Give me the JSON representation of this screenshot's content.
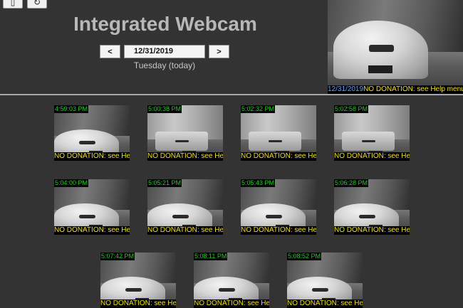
{
  "toolbar": {
    "btn1_glyph": "▯",
    "btn2_glyph": "↻",
    "btn1_icon": "window-icon",
    "btn2_icon": "refresh-icon"
  },
  "header": {
    "title": "Integrated Webcam",
    "prev_label": "<",
    "next_label": ">",
    "date_value": "12/31/2019",
    "day_text": "Tuesday (today)"
  },
  "preview": {
    "date": "12/31/2019",
    "message": "NO DONATION: see Help menu"
  },
  "thumbnails": [
    {
      "time": "4:59:03 PM",
      "caption": "NO DONATION: see Help menu",
      "scene": "car"
    },
    {
      "time": "5:00:38 PM",
      "caption": "NO DONATION: see Help menu",
      "scene": "truck"
    },
    {
      "time": "5:02:32 PM",
      "caption": "NO DONATION: see Help menu",
      "scene": "truck"
    },
    {
      "time": "5:02:58 PM",
      "caption": "NO DONATION: see Help menu",
      "scene": "truck"
    },
    {
      "time": "5:04:00 PM",
      "caption": "NO DONATION: see Help menu",
      "scene": "car"
    },
    {
      "time": "5:05:21 PM",
      "caption": "NO DONATION: see Help menu",
      "scene": "car"
    },
    {
      "time": "5:05:43 PM",
      "caption": "NO DONATION: see Help menu",
      "scene": "car"
    },
    {
      "time": "5:06:28 PM",
      "caption": "NO DONATION: see Help menu",
      "scene": "car"
    },
    {
      "time": "5:07:42 PM",
      "caption": "NO DONATION: see Help menu",
      "scene": "car"
    },
    {
      "time": "5:08:11 PM",
      "caption": "NO DONATION: see Help menu",
      "scene": "car"
    },
    {
      "time": "5:08:52 PM",
      "caption": "NO DONATION: see Help menu",
      "scene": "car"
    }
  ]
}
